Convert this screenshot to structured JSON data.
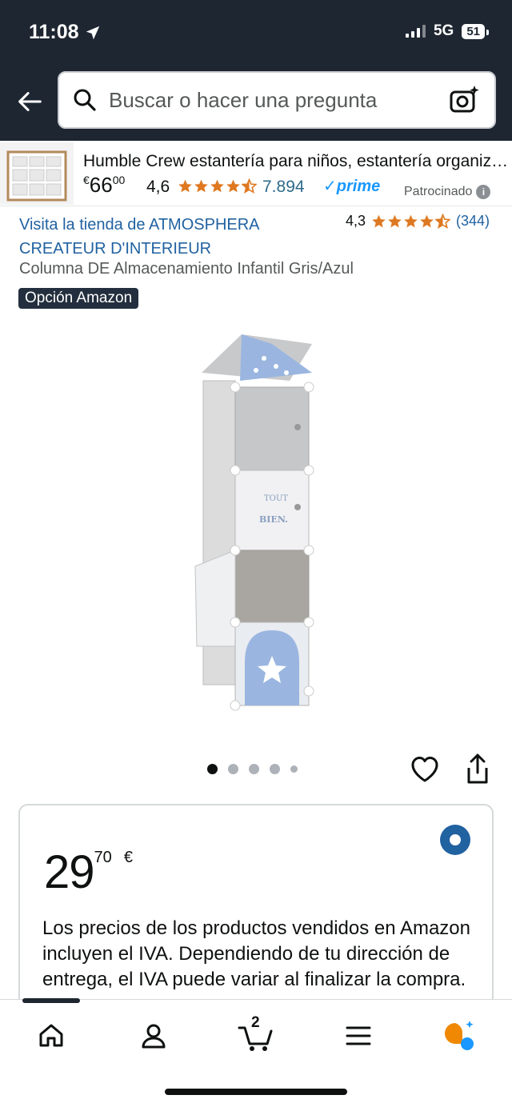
{
  "status_bar": {
    "time": "11:08",
    "network": "5G",
    "battery": "51"
  },
  "search": {
    "placeholder": "Buscar o hacer una pregunta"
  },
  "sponsored": {
    "title": "Humble Crew estantería para niños, estantería organizadora",
    "price_currency": "€",
    "price_whole": "66",
    "price_fraction": "00",
    "rating": "4,6",
    "stars": 4.5,
    "review_count": "7.894",
    "prime_label": "✓prime",
    "sponsored_label": "Patrocinado"
  },
  "product": {
    "store_link": "Visita la tienda de ATMOSPHERA CREATEUR D'INTERIEUR",
    "rating": "4,3",
    "stars": 4.5,
    "review_count": "(344)",
    "title": "Columna DE Almacenamiento Infantil Gris/Azul",
    "badge": "Opción Amazon"
  },
  "gallery": {
    "images": 5,
    "active_index": 0
  },
  "price_card": {
    "price_whole": "29",
    "price_fraction": "70",
    "currency": "€",
    "vat_text": "Los precios de los productos vendidos en Amazon incluyen el IVA. Dependiendo de tu dirección de entrega, el IVA puede variar al finalizar la compra."
  },
  "bottom_nav": {
    "items": [
      "home",
      "account",
      "cart",
      "menu",
      "rufus"
    ],
    "cart_count": "2"
  },
  "colors": {
    "header": "#1e2631",
    "link": "#2162a1",
    "star": "#de7921",
    "prime": "#1a98ff"
  }
}
